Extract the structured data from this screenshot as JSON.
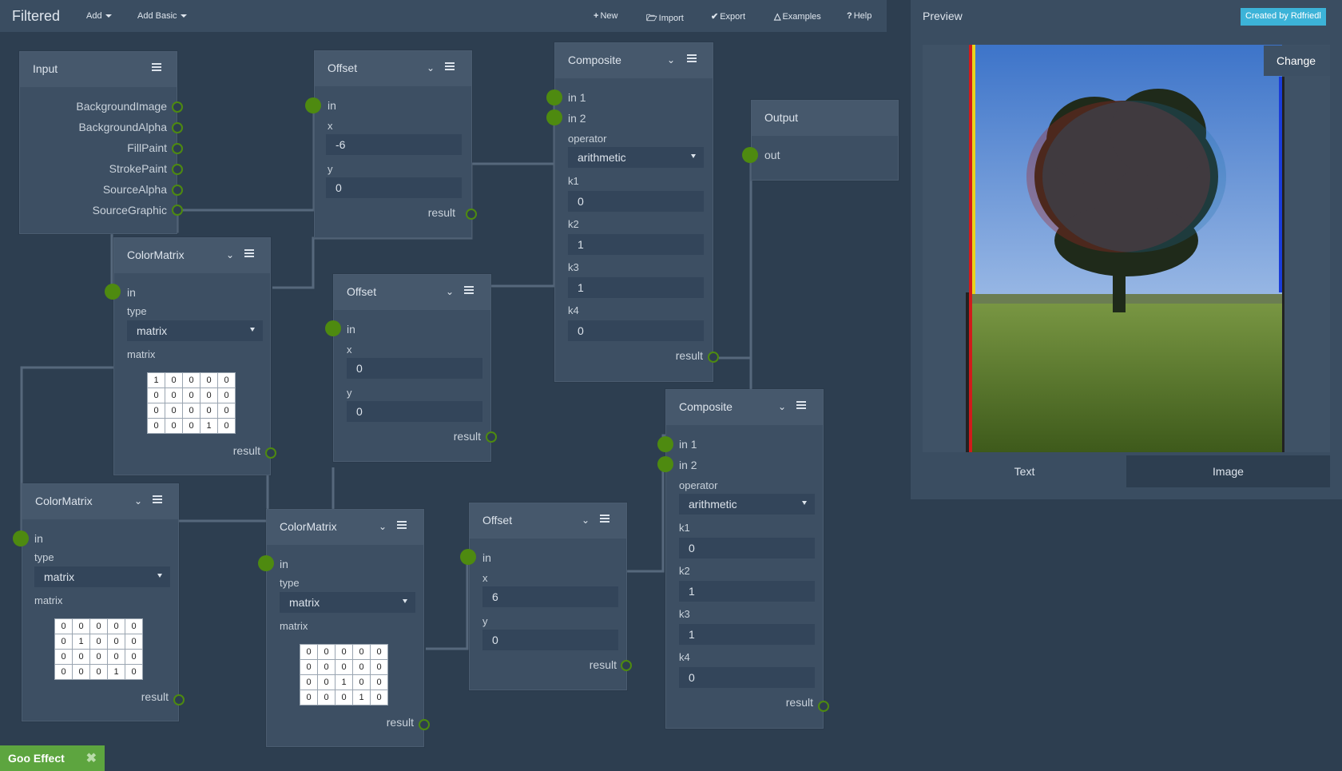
{
  "app": {
    "title": "Filtered"
  },
  "menus": {
    "add": "Add",
    "add_basic": "Add Basic"
  },
  "toolbar": {
    "new": "New",
    "import": "Import",
    "export": "Export",
    "examples": "Examples",
    "help": "Help"
  },
  "nodes": {
    "input": {
      "title": "Input",
      "outputs": [
        "BackgroundImage",
        "BackgroundAlpha",
        "FillPaint",
        "StrokePaint",
        "SourceAlpha",
        "SourceGraphic"
      ]
    },
    "offset1": {
      "title": "Offset",
      "in": "in",
      "x_label": "x",
      "x": "-6",
      "y_label": "y",
      "y": "0",
      "result": "result"
    },
    "composite1": {
      "title": "Composite",
      "in1": "in 1",
      "in2": "in 2",
      "operator_label": "operator",
      "operator": "arithmetic",
      "k1_label": "k1",
      "k1": "0",
      "k2_label": "k2",
      "k2": "1",
      "k3_label": "k3",
      "k3": "1",
      "k4_label": "k4",
      "k4": "0",
      "result": "result"
    },
    "output": {
      "title": "Output",
      "out": "out"
    },
    "colormatrix1": {
      "title": "ColorMatrix",
      "in": "in",
      "type_label": "type",
      "type": "matrix",
      "matrix_label": "matrix",
      "matrix": [
        [
          "1",
          "0",
          "0",
          "0",
          "0"
        ],
        [
          "0",
          "0",
          "0",
          "0",
          "0"
        ],
        [
          "0",
          "0",
          "0",
          "0",
          "0"
        ],
        [
          "0",
          "0",
          "0",
          "1",
          "0"
        ]
      ],
      "result": "result"
    },
    "offset2": {
      "title": "Offset",
      "in": "in",
      "x_label": "x",
      "x": "0",
      "y_label": "y",
      "y": "0",
      "result": "result"
    },
    "colormatrix2": {
      "title": "ColorMatrix",
      "in": "in",
      "type_label": "type",
      "type": "matrix",
      "matrix_label": "matrix",
      "matrix": [
        [
          "0",
          "0",
          "0",
          "0",
          "0"
        ],
        [
          "0",
          "1",
          "0",
          "0",
          "0"
        ],
        [
          "0",
          "0",
          "0",
          "0",
          "0"
        ],
        [
          "0",
          "0",
          "0",
          "1",
          "0"
        ]
      ],
      "result": "result"
    },
    "colormatrix3": {
      "title": "ColorMatrix",
      "in": "in",
      "type_label": "type",
      "type": "matrix",
      "matrix_label": "matrix",
      "matrix": [
        [
          "0",
          "0",
          "0",
          "0",
          "0"
        ],
        [
          "0",
          "0",
          "0",
          "0",
          "0"
        ],
        [
          "0",
          "0",
          "1",
          "0",
          "0"
        ],
        [
          "0",
          "0",
          "0",
          "1",
          "0"
        ]
      ],
      "result": "result"
    },
    "offset3": {
      "title": "Offset",
      "in": "in",
      "x_label": "x",
      "x": "6",
      "y_label": "y",
      "y": "0",
      "result": "result"
    },
    "composite2": {
      "title": "Composite",
      "in1": "in 1",
      "in2": "in 2",
      "operator_label": "operator",
      "operator": "arithmetic",
      "k1_label": "k1",
      "k1": "0",
      "k2_label": "k2",
      "k2": "1",
      "k3_label": "k3",
      "k3": "1",
      "k4_label": "k4",
      "k4": "0",
      "result": "result"
    }
  },
  "preview": {
    "title": "Preview",
    "credit": "Created by Rdfriedl",
    "change": "Change",
    "tab_text": "Text",
    "tab_image": "Image"
  },
  "effect": {
    "name": "Goo Effect"
  },
  "colors": {
    "port": "#4e8a10",
    "credit": "#3cb3d8",
    "effect": "#5da53f"
  }
}
